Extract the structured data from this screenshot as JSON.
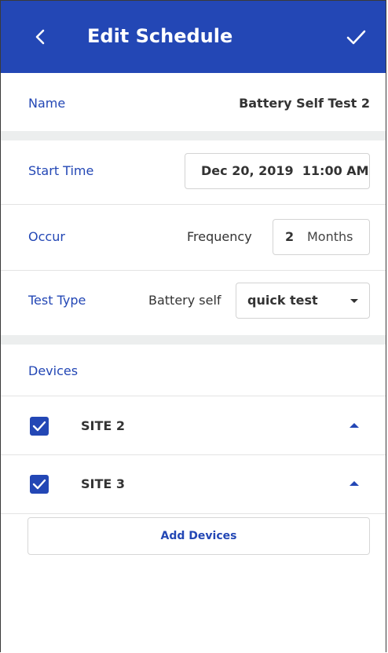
{
  "header": {
    "title": "Edit Schedule",
    "back_icon": "chevron-left-icon",
    "confirm_icon": "check-icon"
  },
  "name": {
    "label": "Name",
    "value": "Battery Self Test 2"
  },
  "start_time": {
    "label": "Start Time",
    "value": "Dec 20, 2019  11:00 AM"
  },
  "occur": {
    "label": "Occur",
    "frequency_label": "Frequency",
    "frequency_value": "2",
    "frequency_unit": "Months"
  },
  "test_type": {
    "label": "Test Type",
    "prefix": "Battery self",
    "selected": "quick test"
  },
  "devices": {
    "label": "Devices",
    "items": [
      {
        "label": "SITE 2",
        "checked": true
      },
      {
        "label": "SITE 3",
        "checked": true
      }
    ],
    "add_button": "Add Devices"
  },
  "colors": {
    "accent": "#2347b5",
    "separator": "#eceeee"
  }
}
